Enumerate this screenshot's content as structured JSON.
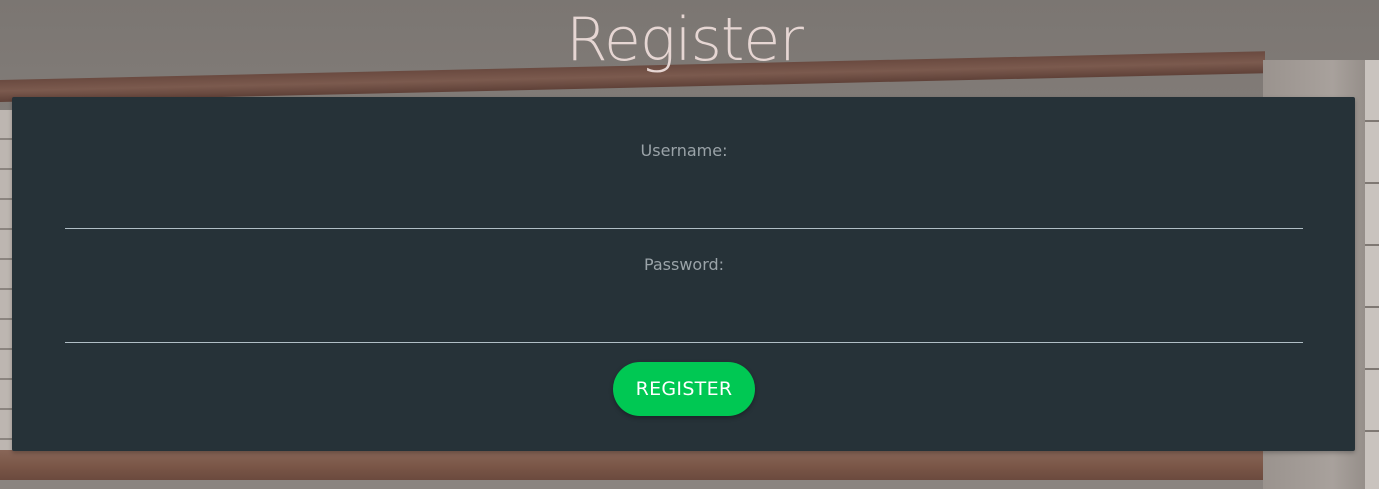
{
  "page": {
    "title": "Register"
  },
  "form": {
    "username": {
      "label": "Username:",
      "value": "",
      "placeholder": ""
    },
    "password": {
      "label": "Password:",
      "value": "",
      "placeholder": ""
    },
    "submit_label": "REGISTER"
  },
  "colors": {
    "card_background": "#263238",
    "accent_button": "#00c853",
    "title_text": "#e6d6d3",
    "label_text": "#9aa3a8",
    "input_underline": "#b0bec5"
  }
}
